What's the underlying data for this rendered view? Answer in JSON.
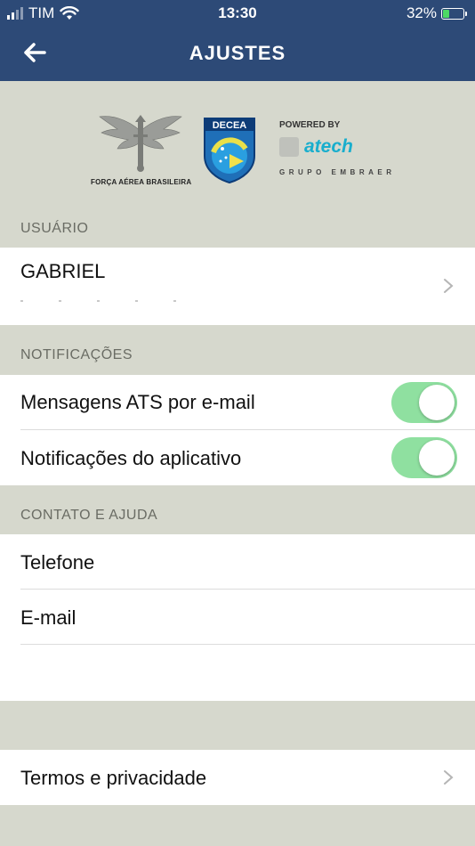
{
  "status": {
    "carrier": "TIM",
    "time": "13:30",
    "battery_percent": "32%",
    "signal_bars": 2,
    "battery_level": 0.32
  },
  "nav": {
    "title": "AJUSTES",
    "back_icon": "arrow-left-icon"
  },
  "logos": {
    "fab_caption": "FORÇA AÉREA BRASILEIRA",
    "decea_name": "DECEA",
    "powered_by": "POWERED BY",
    "atech_name": "atech",
    "atech_group": "GRUPO EMBRAER"
  },
  "sections": {
    "user": {
      "header": "USUÁRIO",
      "name": "GABRIEL"
    },
    "notifications": {
      "header": "NOTIFICAÇÕES",
      "items": [
        {
          "label": "Mensagens ATS por e-mail",
          "enabled": true
        },
        {
          "label": "Notificações do aplicativo",
          "enabled": true
        }
      ]
    },
    "contact": {
      "header": "CONTATO E AJUDA",
      "items": [
        {
          "label": "Telefone"
        },
        {
          "label": "E-mail"
        }
      ]
    },
    "terms": {
      "label": "Termos e privacidade"
    }
  },
  "colors": {
    "nav_bar": "#2d4a77",
    "background": "#d6d8cd",
    "toggle_on": "#8fe0a0",
    "atech_blue": "#19aecd"
  }
}
